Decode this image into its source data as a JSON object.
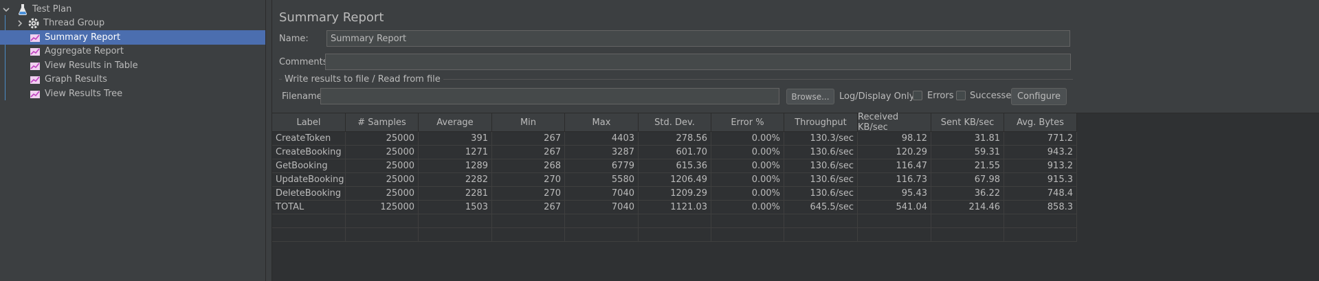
{
  "tree": {
    "items": [
      {
        "label": "Test Plan",
        "icon": "flask-icon",
        "expanded": true
      },
      {
        "label": "Thread Group",
        "icon": "gear-icon",
        "expanded": false
      },
      {
        "label": "Summary Report",
        "icon": "report-icon",
        "selected": true
      },
      {
        "label": "Aggregate Report",
        "icon": "report-icon"
      },
      {
        "label": "View Results in Table",
        "icon": "report-icon"
      },
      {
        "label": "Graph Results",
        "icon": "report-icon"
      },
      {
        "label": "View Results Tree",
        "icon": "report-icon"
      }
    ]
  },
  "main": {
    "title": "Summary Report",
    "name_label": "Name:",
    "name_value": "Summary Report",
    "comments_label": "Comments:",
    "comments_value": "",
    "file_group_title": "Write results to file / Read from file",
    "filename_label": "Filename",
    "filename_value": "",
    "browse_label": "Browse...",
    "log_display_label": "Log/Display Only:",
    "errors_label": "Errors",
    "successes_label": "Successes",
    "configure_label": "Configure"
  },
  "table": {
    "columns": [
      "Label",
      "# Samples",
      "Average",
      "Min",
      "Max",
      "Std. Dev.",
      "Error %",
      "Throughput",
      "Received KB/sec",
      "Sent KB/sec",
      "Avg. Bytes"
    ],
    "rows": [
      [
        "CreateToken",
        "25000",
        "391",
        "267",
        "4403",
        "278.56",
        "0.00%",
        "130.3/sec",
        "98.12",
        "31.81",
        "771.2"
      ],
      [
        "CreateBooking",
        "25000",
        "1271",
        "267",
        "3287",
        "601.70",
        "0.00%",
        "130.6/sec",
        "120.29",
        "59.31",
        "943.2"
      ],
      [
        "GetBooking",
        "25000",
        "1289",
        "268",
        "6779",
        "615.36",
        "0.00%",
        "130.6/sec",
        "116.47",
        "21.55",
        "913.2"
      ],
      [
        "UpdateBooking",
        "25000",
        "2282",
        "270",
        "5580",
        "1206.49",
        "0.00%",
        "130.6/sec",
        "116.73",
        "67.98",
        "915.3"
      ],
      [
        "DeleteBooking",
        "25000",
        "2281",
        "270",
        "7040",
        "1209.29",
        "0.00%",
        "130.6/sec",
        "95.43",
        "36.22",
        "748.4"
      ],
      [
        "TOTAL",
        "125000",
        "1503",
        "267",
        "7040",
        "1121.03",
        "0.00%",
        "645.5/sec",
        "541.04",
        "214.46",
        "858.3"
      ]
    ]
  },
  "colors": {
    "background": "#3c3f41",
    "selection": "#4b6eaf",
    "table_bg": "#2f3133",
    "text": "#bbbbbb"
  }
}
